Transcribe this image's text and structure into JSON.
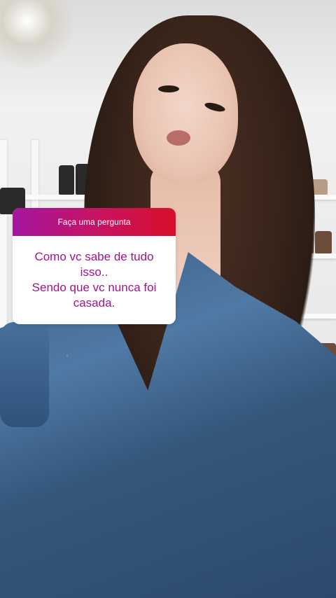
{
  "question_sticker": {
    "header_label": "Faça uma pergunta",
    "question_text": "Como vc sabe de tudo\nisso..\nSendo que vc nunca foi\ncasada."
  },
  "colors": {
    "header_gradient_start": "#a4169f",
    "header_gradient_end": "#d80f2a",
    "question_text": "#a1128c",
    "dress": "#3c5f86"
  }
}
